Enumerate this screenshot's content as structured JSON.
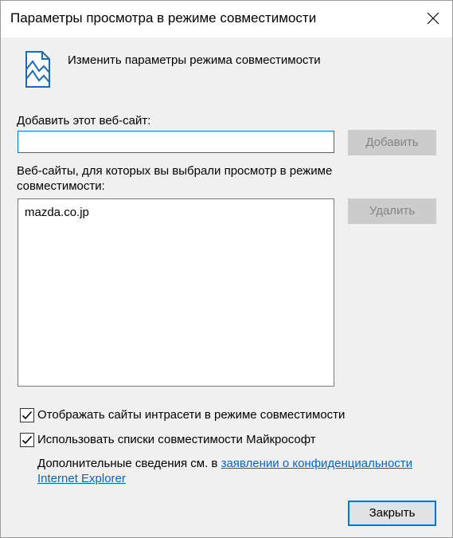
{
  "window": {
    "title": "Параметры просмотра в режиме совместимости",
    "close_icon": "close-icon"
  },
  "header": {
    "icon": "compatibility-view-icon",
    "text": "Изменить параметры режима совместимости"
  },
  "add_section": {
    "label": "Добавить этот веб-сайт:",
    "input_value": "",
    "add_button": "Добавить"
  },
  "list_section": {
    "label": "Веб-сайты, для которых вы выбрали просмотр в режиме совместимости:",
    "items": [
      "mazda.co.jp"
    ],
    "remove_button": "Удалить"
  },
  "options": {
    "intranet": {
      "label": "Отображать сайты интрасети в режиме совместимости",
      "checked": true
    },
    "microsoft_lists": {
      "label": "Использовать списки совместимости Майкрософт",
      "checked": true
    }
  },
  "info": {
    "prefix": "Дополнительные сведения см. в ",
    "link_text": "заявлении о конфиденциальности Internet Explorer"
  },
  "footer": {
    "close_button": "Закрыть"
  },
  "colors": {
    "accent": "#0078d7",
    "link": "#0066cc",
    "disabled_button": "#cccccc"
  }
}
